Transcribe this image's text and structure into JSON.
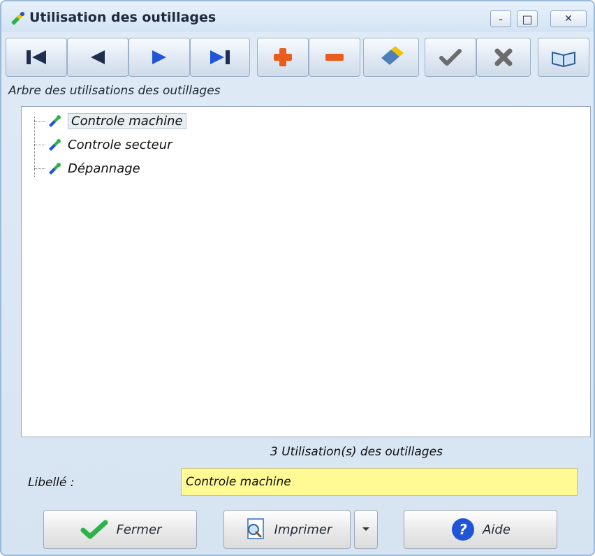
{
  "window": {
    "title": "Utilisation des outillages",
    "icon": "wrench-icon",
    "controls": {
      "minimize": "-",
      "maximize": "□",
      "close": "✕"
    }
  },
  "toolbar": {
    "buttons": [
      {
        "name": "first-record-button",
        "icon": "first-icon"
      },
      {
        "name": "previous-record-button",
        "icon": "previous-icon"
      },
      {
        "name": "next-record-button",
        "icon": "next-icon"
      },
      {
        "name": "last-record-button",
        "icon": "last-icon"
      },
      {
        "name": "add-button",
        "icon": "plus-icon"
      },
      {
        "name": "delete-button",
        "icon": "minus-icon"
      },
      {
        "name": "clear-button",
        "icon": "eraser-icon"
      },
      {
        "name": "validate-button",
        "icon": "check-icon"
      },
      {
        "name": "cancel-button",
        "icon": "cross-icon"
      },
      {
        "name": "help-book-button",
        "icon": "book-icon"
      }
    ]
  },
  "tree": {
    "section_label": "Arbre des utilisations des outillages",
    "items": [
      {
        "label": "Controle machine",
        "selected": true,
        "icon": "wrench-icon"
      },
      {
        "label": "Controle secteur",
        "selected": false,
        "icon": "wrench-icon"
      },
      {
        "label": "Dépannage",
        "selected": false,
        "icon": "wrench-icon"
      }
    ]
  },
  "status": {
    "count_text": "3  Utilisation(s) des outillages"
  },
  "form": {
    "libelle_label": "Libellé :",
    "libelle_value": "Controle machine"
  },
  "actions": {
    "close_label": "Fermer",
    "print_label": "Imprimer",
    "help_label": "Aide"
  },
  "colors": {
    "input_background": "#fffa94",
    "accent_blue": "#1f55d6",
    "accent_red": "#e85d1b",
    "accent_green": "#2bb34a"
  }
}
